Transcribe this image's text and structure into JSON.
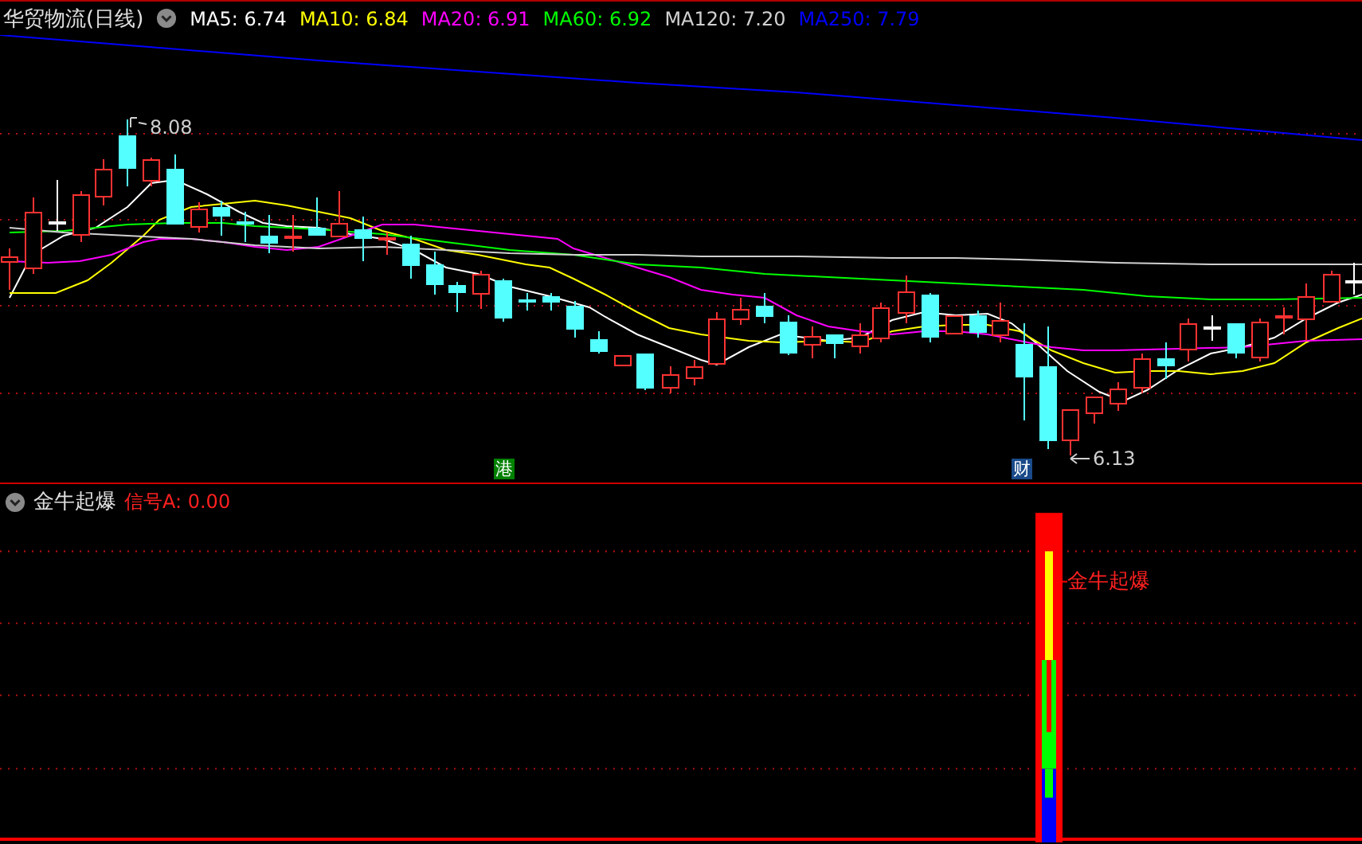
{
  "header": {
    "title": "华贸物流(日线)",
    "indicators": [
      {
        "label": "MA5: 6.74",
        "color": "#ffffff"
      },
      {
        "label": "MA10: 6.84",
        "color": "#ffff00"
      },
      {
        "label": "MA20: 6.91",
        "color": "#ff00ff"
      },
      {
        "label": "MA60: 6.92",
        "color": "#00ff00"
      },
      {
        "label": "MA120: 7.20",
        "color": "#d0d0d0"
      },
      {
        "label": "MA250: 7.79",
        "color": "#0000ff"
      }
    ]
  },
  "main_chart": {
    "high_label": "8.08",
    "low_label": "6.13",
    "markers": [
      {
        "text": "港",
        "color": "#008000"
      },
      {
        "text": "财",
        "color": "#1a4a8a"
      }
    ]
  },
  "indicator_panel": {
    "title": "金牛起爆",
    "signal": "信号A: 0.00",
    "signal_label": "金牛起爆"
  }
}
